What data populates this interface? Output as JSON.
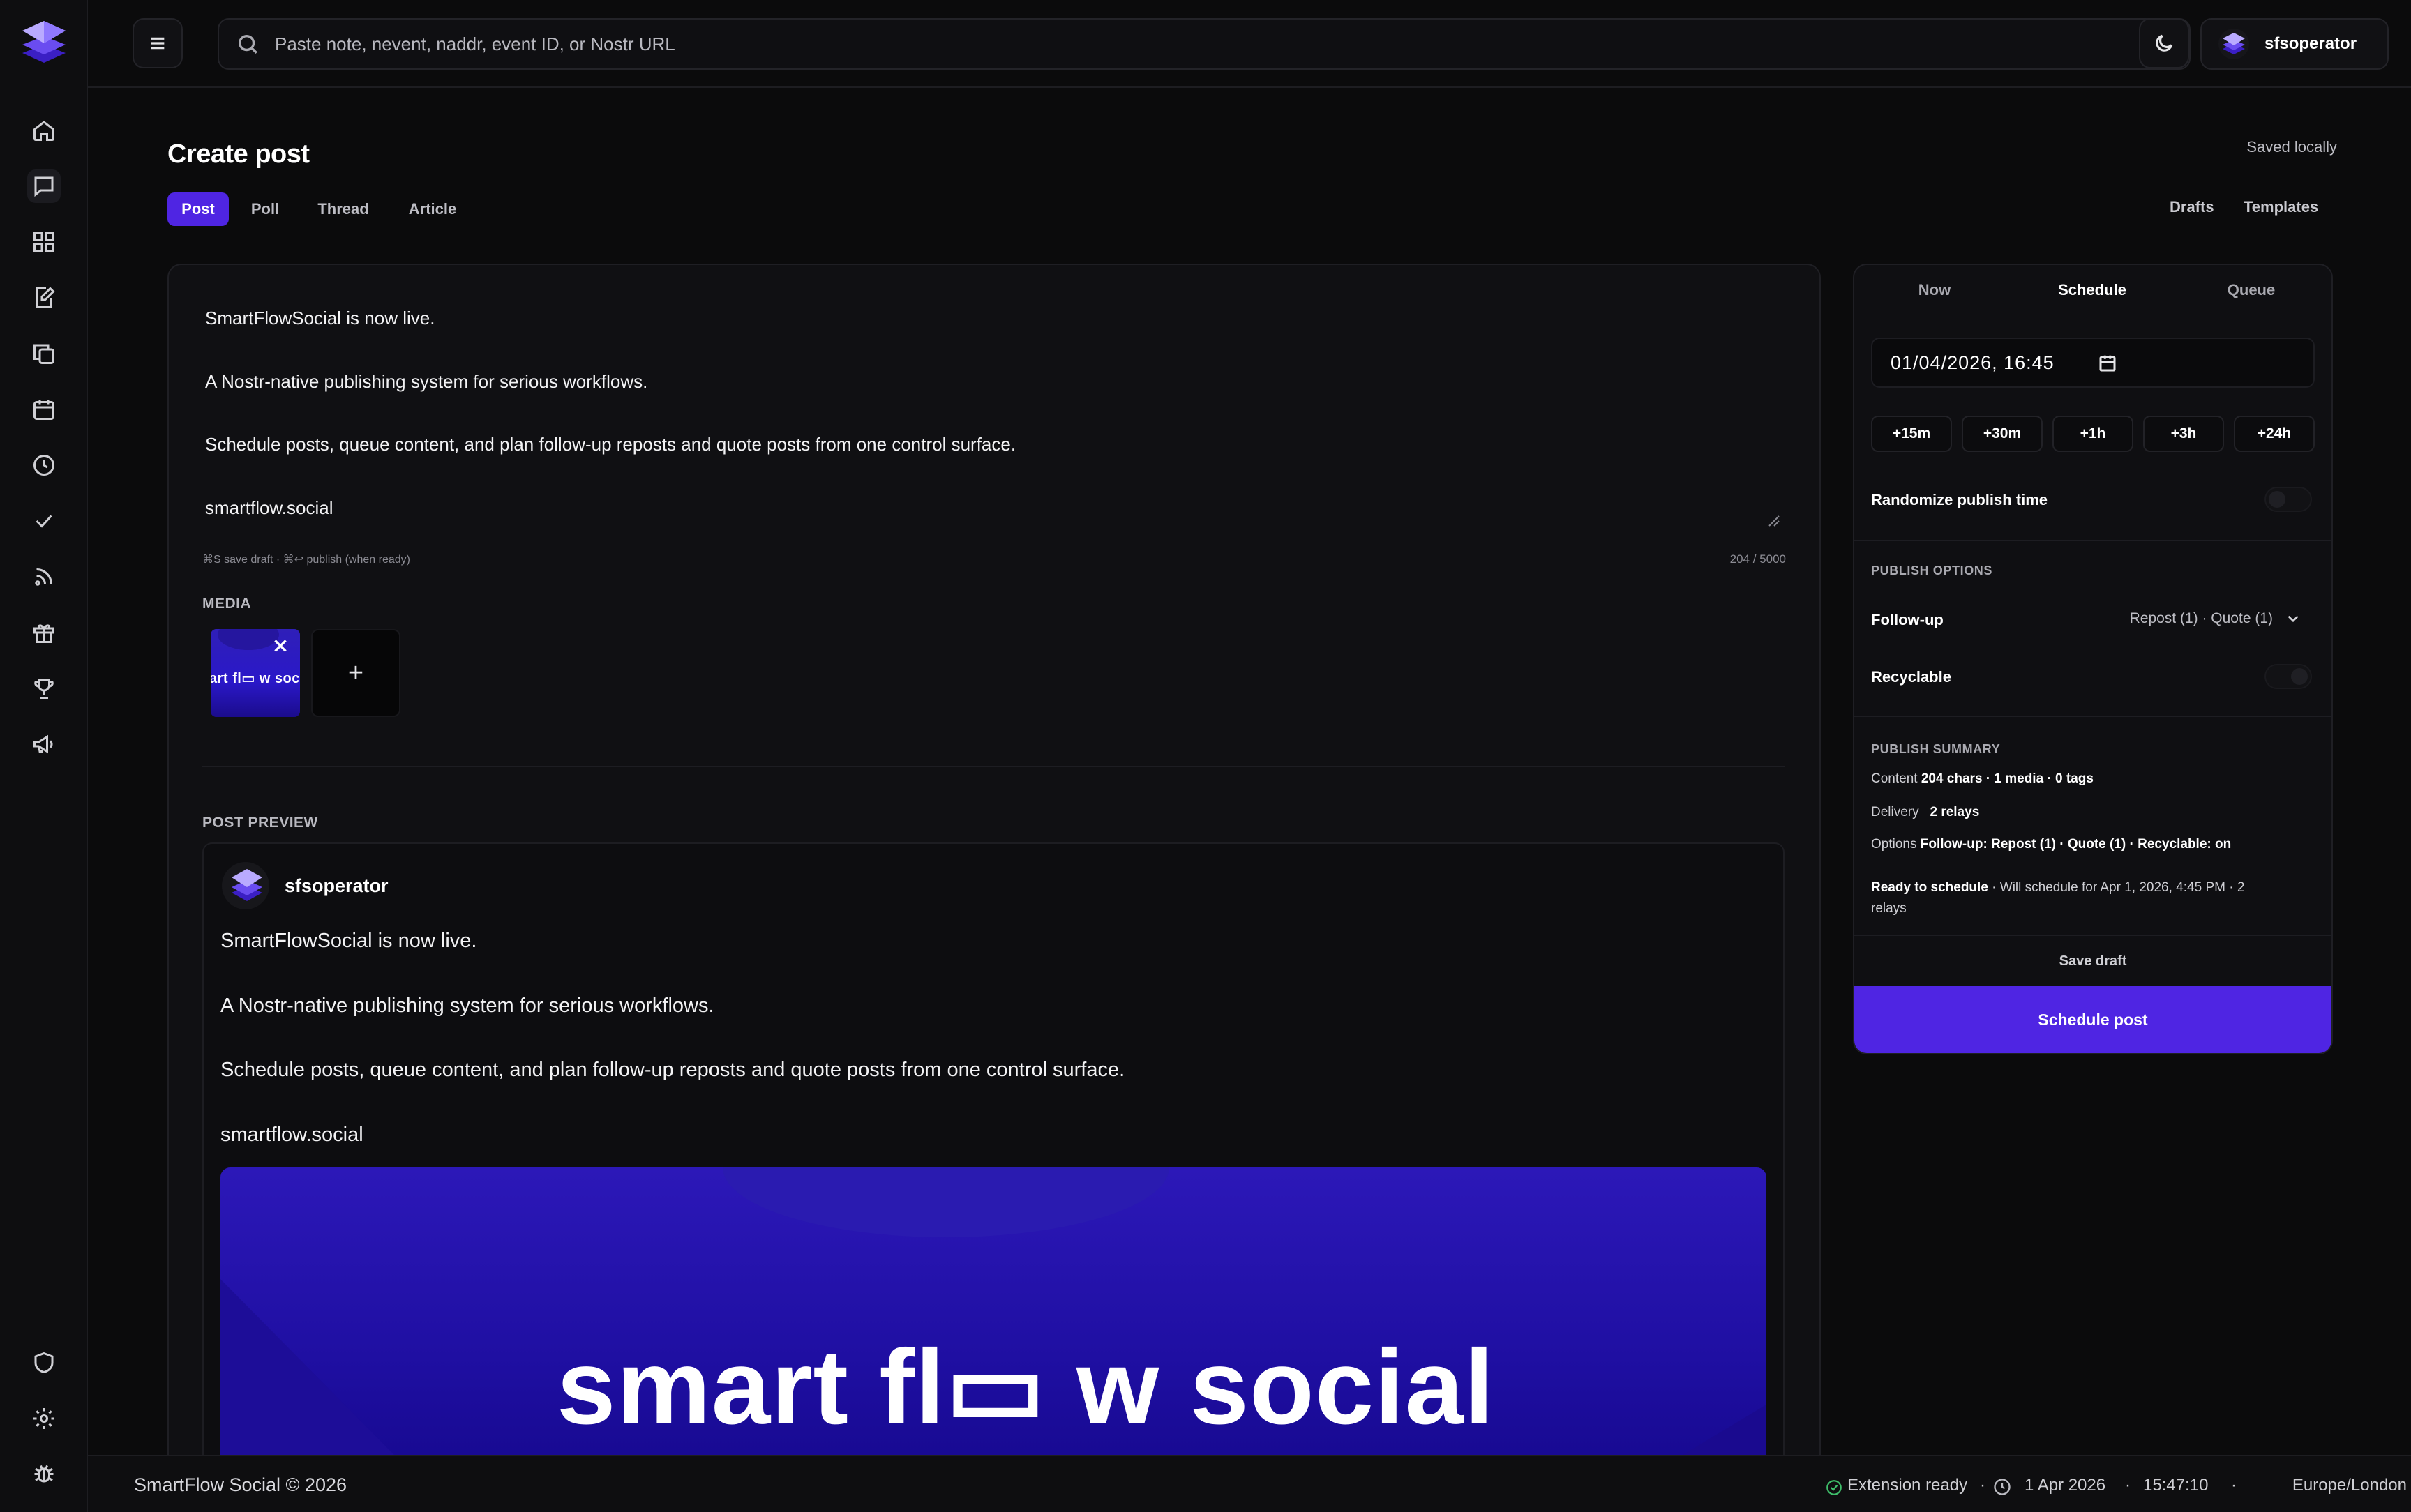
{
  "search": {
    "placeholder": "Paste note, nevent, naddr, event ID, or Nostr URL"
  },
  "user": {
    "name": "sfsoperator"
  },
  "header": {
    "title": "Create post",
    "save_status": "Saved locally",
    "drafts_label": "Drafts",
    "templates_label": "Templates"
  },
  "compose_tabs": [
    {
      "label": "Post",
      "active": true
    },
    {
      "label": "Poll",
      "active": false
    },
    {
      "label": "Thread",
      "active": false
    },
    {
      "label": "Article",
      "active": false
    }
  ],
  "editor": {
    "lines": [
      "SmartFlowSocial is now live.",
      "A Nostr-native publishing system for serious workflows.",
      "Schedule posts, queue content, and plan follow-up reposts and quote posts from one control surface.",
      "smartflow.social"
    ],
    "hint": "⌘S save draft · ⌘↩ publish (when ready)",
    "counter": "204 / 5000"
  },
  "media": {
    "label": "MEDIA",
    "thumb_text": "art fl▭ w soc",
    "add_label": "+"
  },
  "preview": {
    "label": "POST PREVIEW",
    "author": "sfsoperator",
    "lines": [
      "SmartFlowSocial is now live.",
      "A Nostr-native publishing system for serious workflows.",
      "Schedule posts, queue content, and plan follow-up reposts and quote posts from one control surface.",
      "smartflow.social"
    ],
    "banner_text": "smart fl▭ w social"
  },
  "schedule": {
    "modes": [
      {
        "label": "Now",
        "active": false
      },
      {
        "label": "Schedule",
        "active": true
      },
      {
        "label": "Queue",
        "active": false
      }
    ],
    "datetime": "01/04/2026, 16:45",
    "quick_offsets": [
      "+15m",
      "+30m",
      "+1h",
      "+3h",
      "+24h"
    ],
    "randomize_label": "Randomize publish time",
    "randomize_on": false,
    "publish_options_label": "PUBLISH OPTIONS",
    "followup_label": "Follow-up",
    "followup_value": "Repost (1) · Quote (1)",
    "recyclable_label": "Recyclable",
    "recyclable_on": false,
    "summary_label": "PUBLISH SUMMARY",
    "content_key": "Content",
    "content_value": "204 chars · 1 media · 0 tags",
    "delivery_key": "Delivery",
    "delivery_value": "2 relays",
    "options_key": "Options",
    "options_value": "Follow-up: Repost (1) · Quote (1) · Recyclable: on",
    "ready_key": "Ready to schedule",
    "ready_value": " · Will schedule for Apr 1, 2026, 4:45 PM · 2",
    "ready_value_2": "relays",
    "save_draft_label": "Save draft",
    "schedule_button_label": "Schedule post"
  },
  "footer": {
    "copyright": "SmartFlow Social © 2026",
    "extension_status": "Extension ready",
    "date": "1 Apr 2026",
    "time": "15:47:10",
    "timezone": "Europe/London",
    "separator": "·"
  },
  "colors": {
    "accent": "#4f25e3",
    "background": "#0b0b0c",
    "panel": "#101013"
  }
}
